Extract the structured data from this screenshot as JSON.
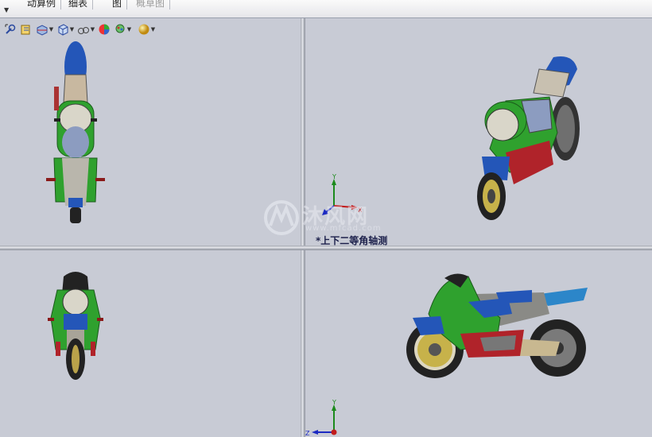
{
  "top_tabs": [
    {
      "label": "动算例",
      "dim": false
    },
    {
      "label": "细表",
      "dim": false
    },
    {
      "label": "图",
      "dim": false
    },
    {
      "label": "概草图",
      "dim": true
    }
  ],
  "view_toolbar": {
    "icons": [
      "zoom-to-fit-icon",
      "previous-view-icon",
      "section-view-icon",
      "view-orientation-icon",
      "display-style-icon",
      "hide-show-items-icon",
      "edit-appearance-icon",
      "apply-scene-icon",
      "view-settings-icon"
    ]
  },
  "viewports": {
    "top_right": {
      "label": "*上下二等角轴测"
    }
  },
  "watermark": {
    "brand": "沐风网",
    "url": "www.mfcad.com"
  },
  "triad_axes": {
    "x": "X",
    "y": "Y",
    "z": "Z"
  },
  "colors": {
    "background": "#c8cbd5",
    "body_green": "#2fa12e",
    "body_blue": "#2459b8",
    "body_red": "#b0232a"
  }
}
